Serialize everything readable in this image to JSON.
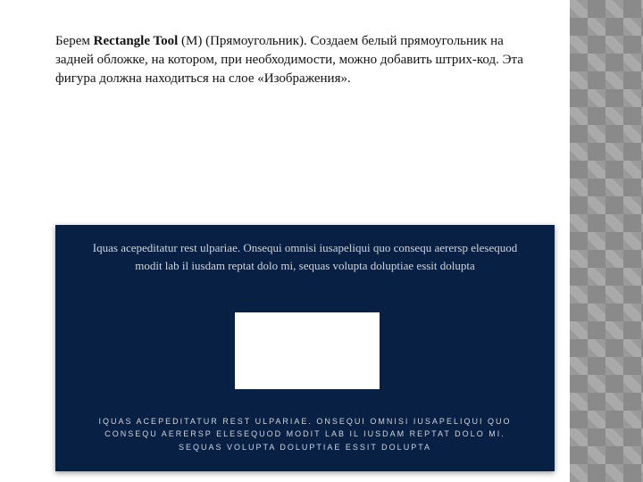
{
  "intro": {
    "prefix": "Берем ",
    "bold": "Rectangle Tool",
    "suffix": " (M) (Прямоугольник). Создаем белый прямоугольник на задней обложке, на котором, при необходимости, можно добавить штрих-код. Эта фигура должна находиться на слое «Изображения»."
  },
  "cover": {
    "top_line": "Iquas acepeditatur rest ulpariae. Onsequi omnisi iusapeliqui quo consequ aerersp elesequod modit lab il iusdam reptat dolo mi, sequas volupta doluptiae essit dolupta",
    "bottom_line": "IQUAS ACEPEDITATUR REST ULPARIAE. ONSEQUI OMNISI IUSAPELIQUI QUO CONSEQU AERERSP ELESEQUOD MODIT LAB IL IUSDAM REPTAT DOLO MI. SEQUAS VOLUPTA DOLUPTIAE ESSIT DOLUPTA"
  }
}
